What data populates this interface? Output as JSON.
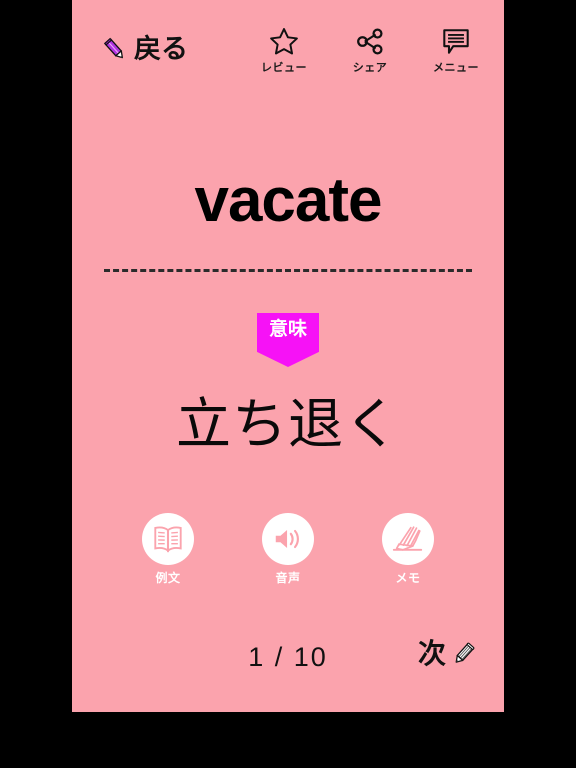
{
  "theme": {
    "card_background": "#fba3ad",
    "letterbox": "#000000",
    "badge_color": "#f612f6",
    "text_color": "#111111",
    "circle_color": "#ffffff"
  },
  "topbar": {
    "back": {
      "label": "戻る",
      "icon": "pencil-icon"
    },
    "actions": [
      {
        "label": "レビュー",
        "icon": "star-icon"
      },
      {
        "label": "シェア",
        "icon": "share-icon"
      },
      {
        "label": "メニュー",
        "icon": "speech-bubble-menu-icon"
      }
    ]
  },
  "flashcard": {
    "headword": "vacate",
    "meaning_badge": "意味",
    "meaning": "立ち退く"
  },
  "tools": [
    {
      "label": "例文",
      "icon": "open-book-icon"
    },
    {
      "label": "音声",
      "icon": "speaker-icon"
    },
    {
      "label": "メモ",
      "icon": "writing-hand-icon"
    }
  ],
  "bottom": {
    "counter": "1 / 10",
    "next_label": "次",
    "next_icon": "pencil-icon"
  }
}
